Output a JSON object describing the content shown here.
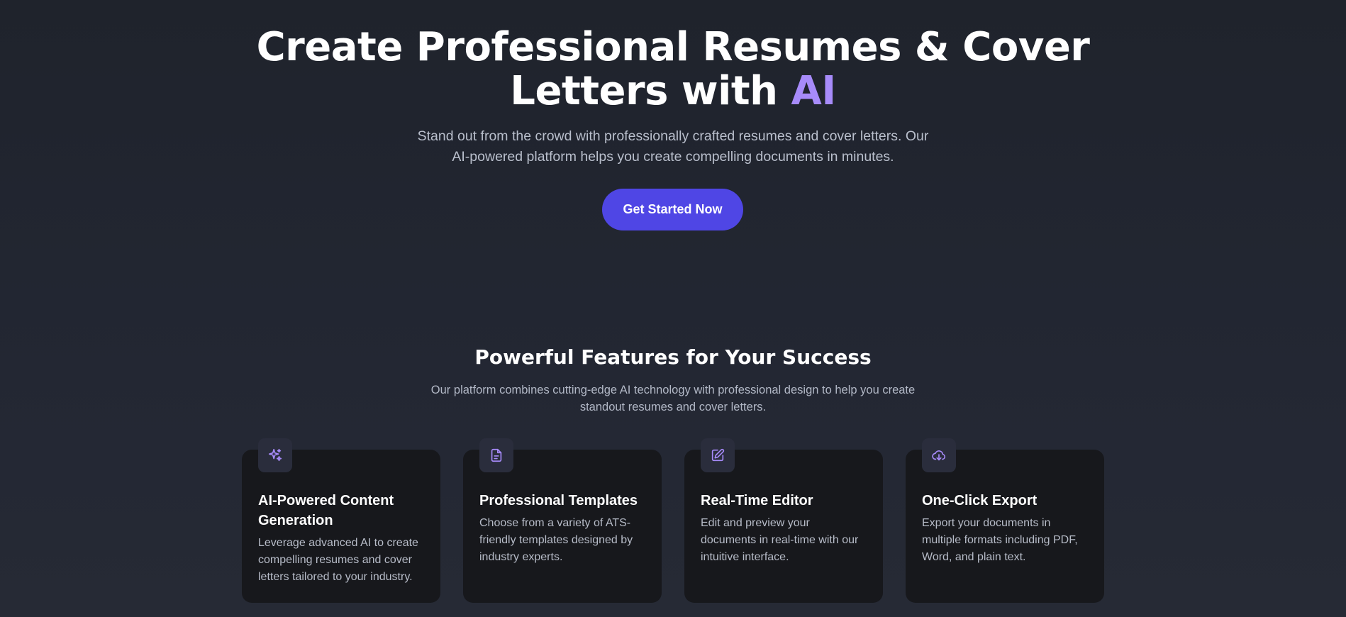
{
  "hero": {
    "title_line1": "Create Professional Resumes & Cover",
    "title_line2_prefix": "Letters with ",
    "title_accent": "AI",
    "subtitle_line1": "Stand out from the crowd with professionally crafted resumes and cover letters. Our",
    "subtitle_line2": "AI-powered platform helps you create compelling documents in minutes.",
    "cta_label": "Get Started Now"
  },
  "features": {
    "title": "Powerful Features for Your Success",
    "subtitle_line1": "Our platform combines cutting-edge AI technology with professional design to help you create",
    "subtitle_line2": "standout resumes and cover letters.",
    "cards": [
      {
        "icon": "sparkles-icon",
        "title_line1": "AI-Powered Content",
        "title_line2": "Generation",
        "desc_line1": "Leverage advanced AI to create",
        "desc_line2": "compelling resumes and cover",
        "desc_line3": "letters tailored to your industry."
      },
      {
        "icon": "document-icon",
        "title_line1": "Professional Templates",
        "desc_line1": "Choose from a variety of ATS-",
        "desc_line2": "friendly templates designed by",
        "desc_line3": "industry experts."
      },
      {
        "icon": "edit-icon",
        "title_line1": "Real-Time Editor",
        "desc_line1": "Edit and preview your",
        "desc_line2": "documents in real-time with our",
        "desc_line3": "intuitive interface."
      },
      {
        "icon": "cloud-download-icon",
        "title_line1": "One-Click Export",
        "desc_line1": "Export your documents in",
        "desc_line2": "multiple formats including PDF,",
        "desc_line3": "Word, and plain text."
      }
    ]
  },
  "colors": {
    "background": "#22262f",
    "accent": "#a78bfa",
    "cta": "#4f46e5",
    "card": "#17181c",
    "icon_tile": "#2a2d3c"
  }
}
